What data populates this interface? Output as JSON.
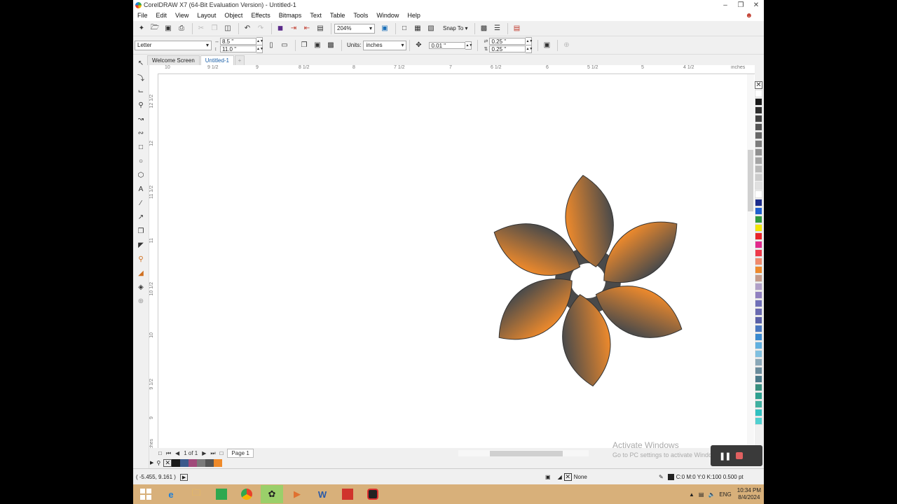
{
  "window": {
    "title": "CorelDRAW X7 (64-Bit Evaluation Version) - Untitled-1",
    "controls": [
      "–",
      "❐",
      "✕"
    ]
  },
  "menu": [
    "File",
    "Edit",
    "View",
    "Layout",
    "Object",
    "Effects",
    "Bitmaps",
    "Text",
    "Table",
    "Tools",
    "Window",
    "Help"
  ],
  "toolbar": {
    "zoom": "204%",
    "snap_to": "Snap To"
  },
  "properties": {
    "page_size": "Letter",
    "width": "8.5 \"",
    "height": "11.0 \"",
    "units_label": "Units:",
    "units": "inches",
    "nudge": "0.01 \"",
    "dup_x": "0.25 \"",
    "dup_y": "0.25 \""
  },
  "tabs": [
    "Welcome Screen",
    "Untitled-1"
  ],
  "ruler": {
    "top": [
      "10",
      "9 1/2",
      "9",
      "8 1/2",
      "8",
      "7 1/2",
      "7",
      "6 1/2",
      "6",
      "5 1/2",
      "5",
      "4 1/2",
      "inches"
    ],
    "left": [
      "12 1/2",
      "12",
      "11 1/2",
      "11",
      "10 1/2",
      "10",
      "9 1/2",
      "9",
      "inches"
    ]
  },
  "pagenav": {
    "count": "1 of 1",
    "page_tab": "Page 1"
  },
  "status": {
    "coords": "( -5.455, 9.161 )",
    "fill": "None",
    "outline": "C:0 M:0 Y:0 K:100  0.500 pt"
  },
  "watermark": {
    "line1": "Activate Windows",
    "line2": "Go to PC settings to activate Windows."
  },
  "taskbar": {
    "lang": "ENG",
    "time": "10:34 PM",
    "date": "8/4/2024"
  },
  "colors": {
    "petal_light": "#ee8a2c",
    "petal_dark": "#4a4a4a",
    "taskbar": "#d8b07a",
    "doc_palette": [
      "#1a1a1a",
      "#3c5a8c",
      "#a04a7a",
      "#7a7a7a",
      "#555555",
      "#ef8a2a"
    ],
    "palette": [
      "#ffffff",
      "#1a1a1a",
      "#2e2e2e",
      "#424242",
      "#555555",
      "#686868",
      "#7c7c7c",
      "#909090",
      "#a4a4a4",
      "#b8b8b8",
      "#cccccc",
      "#e0e0e0",
      "#ffffff",
      "#1d2d8c",
      "#1e5fd0",
      "#2f9a3e",
      "#f2e600",
      "#e8242a",
      "#e22a8c",
      "#ee3a4a",
      "#f08a6c",
      "#ee8a2c",
      "#c49a8a",
      "#b0a0c8",
      "#9080c0",
      "#7070b8",
      "#6a6ab0",
      "#5a60a8",
      "#4a78c0",
      "#3a8ad0",
      "#60b0e0",
      "#80c0e0",
      "#8aa8b8",
      "#6a8c9c",
      "#4a7a8a",
      "#3a9080",
      "#2ea090",
      "#40b0a0",
      "#30c0c0",
      "#50d0d0"
    ]
  },
  "icons": {
    "toolbox": [
      "pick-tool-icon",
      "shape-tool-icon",
      "crop-tool-icon",
      "zoom-tool-icon",
      "freehand-tool-icon",
      "artistic-media-icon",
      "rectangle-tool-icon",
      "ellipse-tool-icon",
      "polygon-tool-icon",
      "text-tool-icon",
      "parallel-dimension-icon",
      "connector-tool-icon",
      "drop-shadow-icon",
      "transparency-icon",
      "color-eyedropper-icon",
      "interactive-fill-icon",
      "smart-fill-icon",
      "add-tool-icon"
    ],
    "taskbar": [
      "start-icon",
      "internet-explorer-icon",
      "file-explorer-icon",
      "store-icon",
      "chrome-icon",
      "coreldraw-icon",
      "media-player-icon",
      "word-icon",
      "acrobat-icon",
      "recorder-icon"
    ]
  }
}
